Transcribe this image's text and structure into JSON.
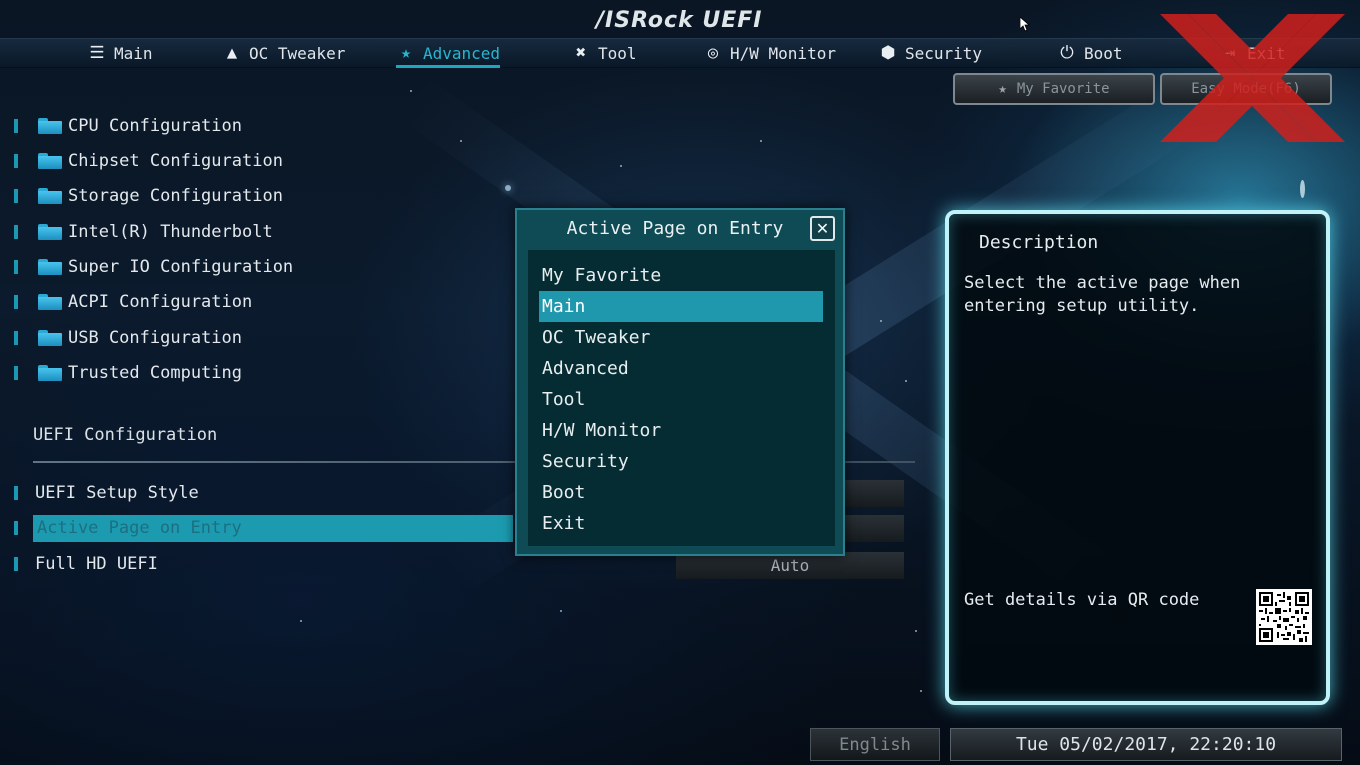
{
  "app": {
    "logo": "/ISRock UEFI"
  },
  "nav": {
    "tabs": [
      {
        "label": "Main",
        "icon": "list-icon"
      },
      {
        "label": "OC Tweaker",
        "icon": "rocket-icon"
      },
      {
        "label": "Advanced",
        "icon": "star-icon",
        "active": true
      },
      {
        "label": "Tool",
        "icon": "tools-icon"
      },
      {
        "label": "H/W Monitor",
        "icon": "monitor-icon"
      },
      {
        "label": "Security",
        "icon": "shield-icon"
      },
      {
        "label": "Boot",
        "icon": "power-icon"
      },
      {
        "label": "Exit",
        "icon": "exit-icon"
      }
    ],
    "my_favorite": "My Favorite",
    "easy_mode": "Easy Mode(F6)"
  },
  "menu": {
    "items": [
      "CPU Configuration",
      "Chipset Configuration",
      "Storage Configuration",
      "Intel(R) Thunderbolt",
      "Super IO Configuration",
      "ACPI Configuration",
      "USB Configuration",
      "Trusted Computing"
    ]
  },
  "uefi": {
    "section_title": "UEFI Configuration",
    "items": [
      {
        "label": "UEFI Setup Style",
        "value": ""
      },
      {
        "label": "Active Page on Entry",
        "value": "",
        "selected": true
      },
      {
        "label": "Full HD UEFI",
        "value": "Auto"
      }
    ]
  },
  "dialog": {
    "title": "Active Page on Entry",
    "close": "✕",
    "options": [
      "My Favorite",
      "Main",
      "OC Tweaker",
      "Advanced",
      "Tool",
      "H/W Monitor",
      "Security",
      "Boot",
      "Exit"
    ],
    "selected": "Main"
  },
  "description": {
    "title": "Description",
    "text": "Select the active page when entering setup utility.",
    "qr_label": "Get details via QR code"
  },
  "footer": {
    "language": "English",
    "datetime": "Tue 05/02/2017, 22:20:10"
  },
  "colors": {
    "accent": "#1f98ad",
    "dialog_bg": "#0f4b55",
    "panel_glow": "#bff3f8",
    "watermark": "#d0201c"
  }
}
